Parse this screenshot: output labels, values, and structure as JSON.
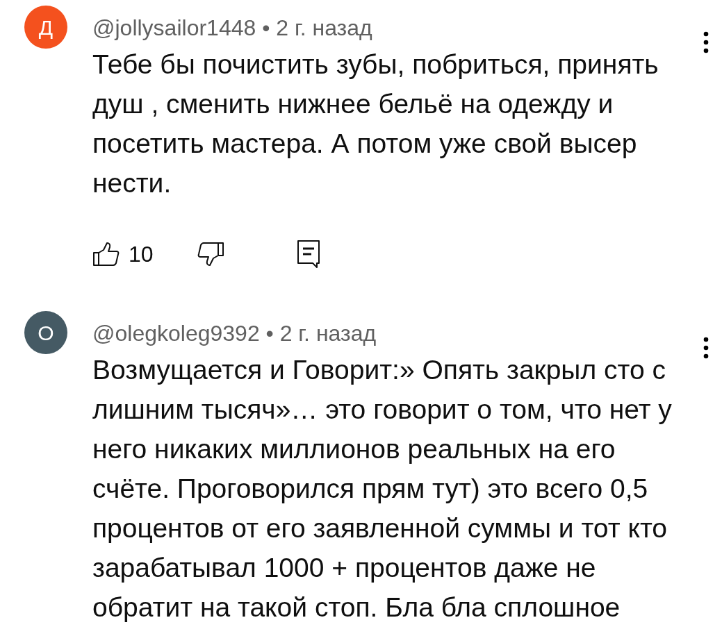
{
  "comments": [
    {
      "avatar_letter": "Д",
      "color": "#f4511e",
      "meta": "@jollysailor1448 • 2 г. назад",
      "text": "Тебе бы почистить зубы, побриться, принять душ , сменить нижнее бельё на одежду и посетить мастера. А потом уже свой высер нести.",
      "likes": "10"
    },
    {
      "avatar_letter": "О",
      "color": "#455a64",
      "meta": "@olegkoleg9392 • 2 г. назад",
      "text": "Возмущается и Говорит:» Опять закрыл сто с лишним тысяч»… это говорит о том, что нет у него никаких миллионов реальных на его счёте. Проговорился прям тут) это всего 0,5 процентов от его заявленной суммы и тот кто зарабатывал 1000 + процентов даже не обратит на такой стоп. Бла бла сплошное"
    }
  ]
}
